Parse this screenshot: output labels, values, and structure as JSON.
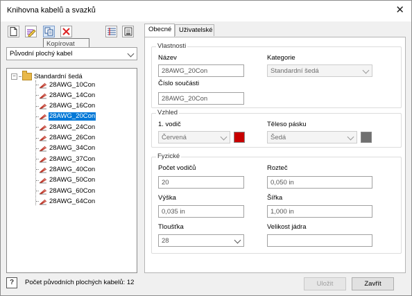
{
  "window": {
    "title": "Knihovna kabelů a svazků",
    "close_glyph": "✕"
  },
  "toolbar": {
    "buttons": [
      {
        "name": "new-icon"
      },
      {
        "name": "edit-icon"
      },
      {
        "name": "copy-icon"
      },
      {
        "name": "delete-icon"
      },
      {
        "name": "import-icon"
      },
      {
        "name": "export-icon"
      }
    ],
    "tooltip": "Kopírovat"
  },
  "library_select": {
    "value": "Původní plochý kabel"
  },
  "tree": {
    "root_label": "Standardní šedá",
    "items": [
      "28AWG_10Con",
      "28AWG_14Con",
      "28AWG_16Con",
      "28AWG_20Con",
      "28AWG_24Con",
      "28AWG_26Con",
      "28AWG_34Con",
      "28AWG_37Con",
      "28AWG_40Con",
      "28AWG_50Con",
      "28AWG_60Con",
      "28AWG_64Con"
    ],
    "selected_index": 3
  },
  "tabs": [
    "Obecné",
    "Uživatelské"
  ],
  "properties": {
    "group_title": "Vlastnosti",
    "name_label": "Název",
    "name_value": "28AWG_20Con",
    "part_number_label": "Číslo součásti",
    "part_number_value": "28AWG_20Con",
    "category_label": "Kategorie",
    "category_value": "Standardní šedá"
  },
  "appearance": {
    "group_title": "Vzhled",
    "conductor1_label": "1. vodič",
    "conductor1_value": "Červená",
    "conductor1_color": "#c80000",
    "tape_body_label": "Těleso pásku",
    "tape_body_value": "Šedá",
    "tape_body_color": "#707070"
  },
  "physical": {
    "group_title": "Fyzické",
    "conductor_count_label": "Počet vodičů",
    "conductor_count_value": "20",
    "pitch_label": "Rozteč",
    "pitch_value": "0,050 in",
    "height_label": "Výška",
    "height_value": "0,035 in",
    "width_label": "Šířka",
    "width_value": "1,000 in",
    "thickness_label": "Tloušťka",
    "thickness_value": "28",
    "core_size_label": "Velikost jádra",
    "core_size_value": ""
  },
  "footer": {
    "help_glyph": "?",
    "status": "Počet původních plochých kabelů: 12",
    "save_label": "Uložit",
    "close_label": "Zavřít"
  }
}
